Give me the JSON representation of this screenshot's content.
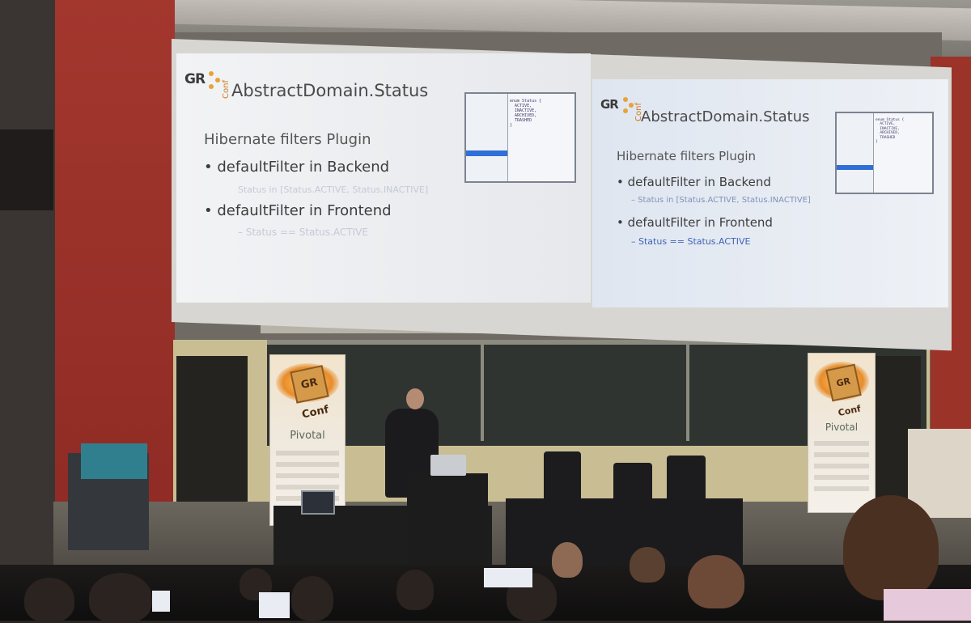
{
  "slides": [
    {
      "title": "AbstractDomain.Status",
      "subtitle": "Hibernate filters Plugin",
      "bullets": [
        {
          "text": "defaultFilter in Backend",
          "sub": "Status in [Status.ACTIVE, Status.INACTIVE]"
        },
        {
          "text": "defaultFilter in Frontend",
          "sub": "Status == Status.ACTIVE"
        }
      ],
      "code": "enum Status {\n  ACTIVE,\n  INACTIVE,\n  ARCHIVED,\n  TRASHED\n}"
    },
    {
      "title": "AbstractDomain.Status",
      "subtitle": "Hibernate filters Plugin",
      "bullets": [
        {
          "text": "defaultFilter in Backend",
          "sub": "Status in [Status.ACTIVE, Status.INACTIVE]"
        },
        {
          "text": "defaultFilter in Frontend",
          "sub": "Status == Status.ACTIVE"
        }
      ],
      "code": "enum Status {\n  ACTIVE,\n  INACTIVE,\n  ARCHIVED,\n  TRASHED\n}"
    }
  ],
  "logo": {
    "main": "GR",
    "secondary": "Conf"
  },
  "banners": [
    {
      "logo": "GR Conf",
      "sponsor": "Pivotal"
    },
    {
      "logo": "GR Conf",
      "sponsor": "Pivotal"
    }
  ],
  "colors": {
    "wall": "#9b3329",
    "screen": "#eef0f3",
    "banner_glow": "#e88c2a",
    "link_blue": "#2f6fd8"
  }
}
